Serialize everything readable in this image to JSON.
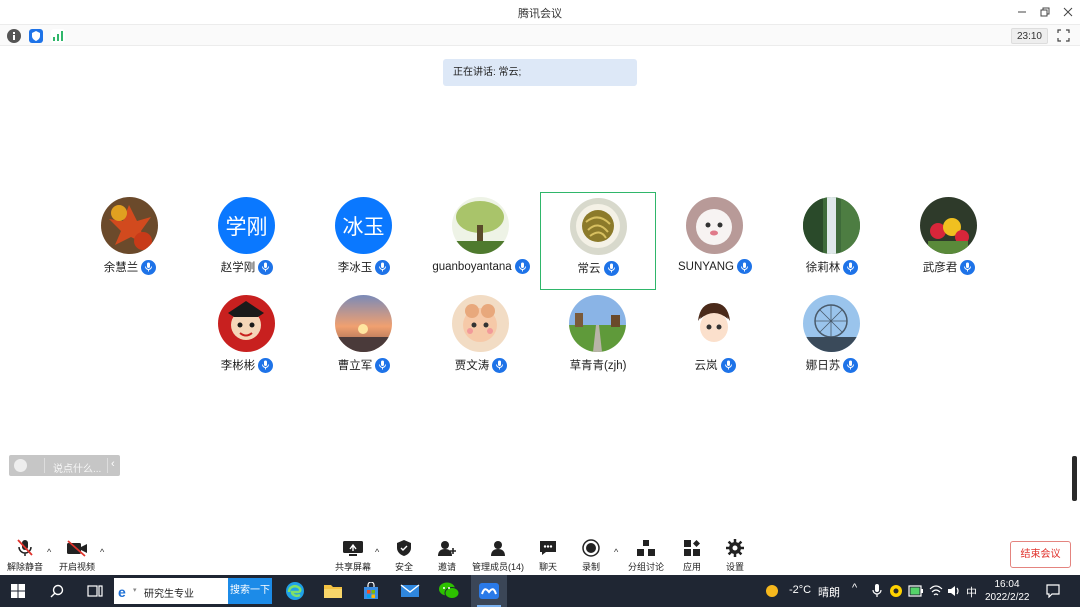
{
  "window": {
    "title": "腾讯会议"
  },
  "infobar": {
    "timer": "23:10"
  },
  "speaking": {
    "text": "正在讲话: 常云;"
  },
  "participants": [
    {
      "name": "余慧兰"
    },
    {
      "name": "赵学刚",
      "avatar_text": "学刚"
    },
    {
      "name": "李冰玉",
      "avatar_text": "冰玉"
    },
    {
      "name": "guanboyantana"
    },
    {
      "name": "常云"
    },
    {
      "name": "SUNYANG"
    },
    {
      "name": "徐莉林"
    },
    {
      "name": "武彦君"
    },
    {
      "name": "李彬彬"
    },
    {
      "name": "曹立军"
    },
    {
      "name": "贾文涛"
    },
    {
      "name": "草青青(zjh)"
    },
    {
      "name": "云岚"
    },
    {
      "name": "娜日苏"
    }
  ],
  "chat": {
    "placeholder": "说点什么..."
  },
  "toolbar": {
    "unmute": "解除静音",
    "start_video": "开启视频",
    "share_screen": "共享屏幕",
    "security": "安全",
    "invite": "邀请",
    "manage_members": "管理成员(14)",
    "chat": "聊天",
    "record": "录制",
    "breakout": "分组讨论",
    "apps": "应用",
    "settings": "设置",
    "end_meeting": "结束会议"
  },
  "taskbar": {
    "search_text": "研究生专业",
    "search_button": "搜索一下",
    "weather_temp": "-2°C",
    "weather_desc": "晴朗",
    "ime": "中",
    "time": "16:04",
    "date": "2022/2/22"
  },
  "colors": {
    "accent_blue": "#0a78ff",
    "active_speaker_border": "#2fb66a",
    "end_meeting_red": "#e0322b",
    "taskbar_bg": "#1f2633"
  }
}
